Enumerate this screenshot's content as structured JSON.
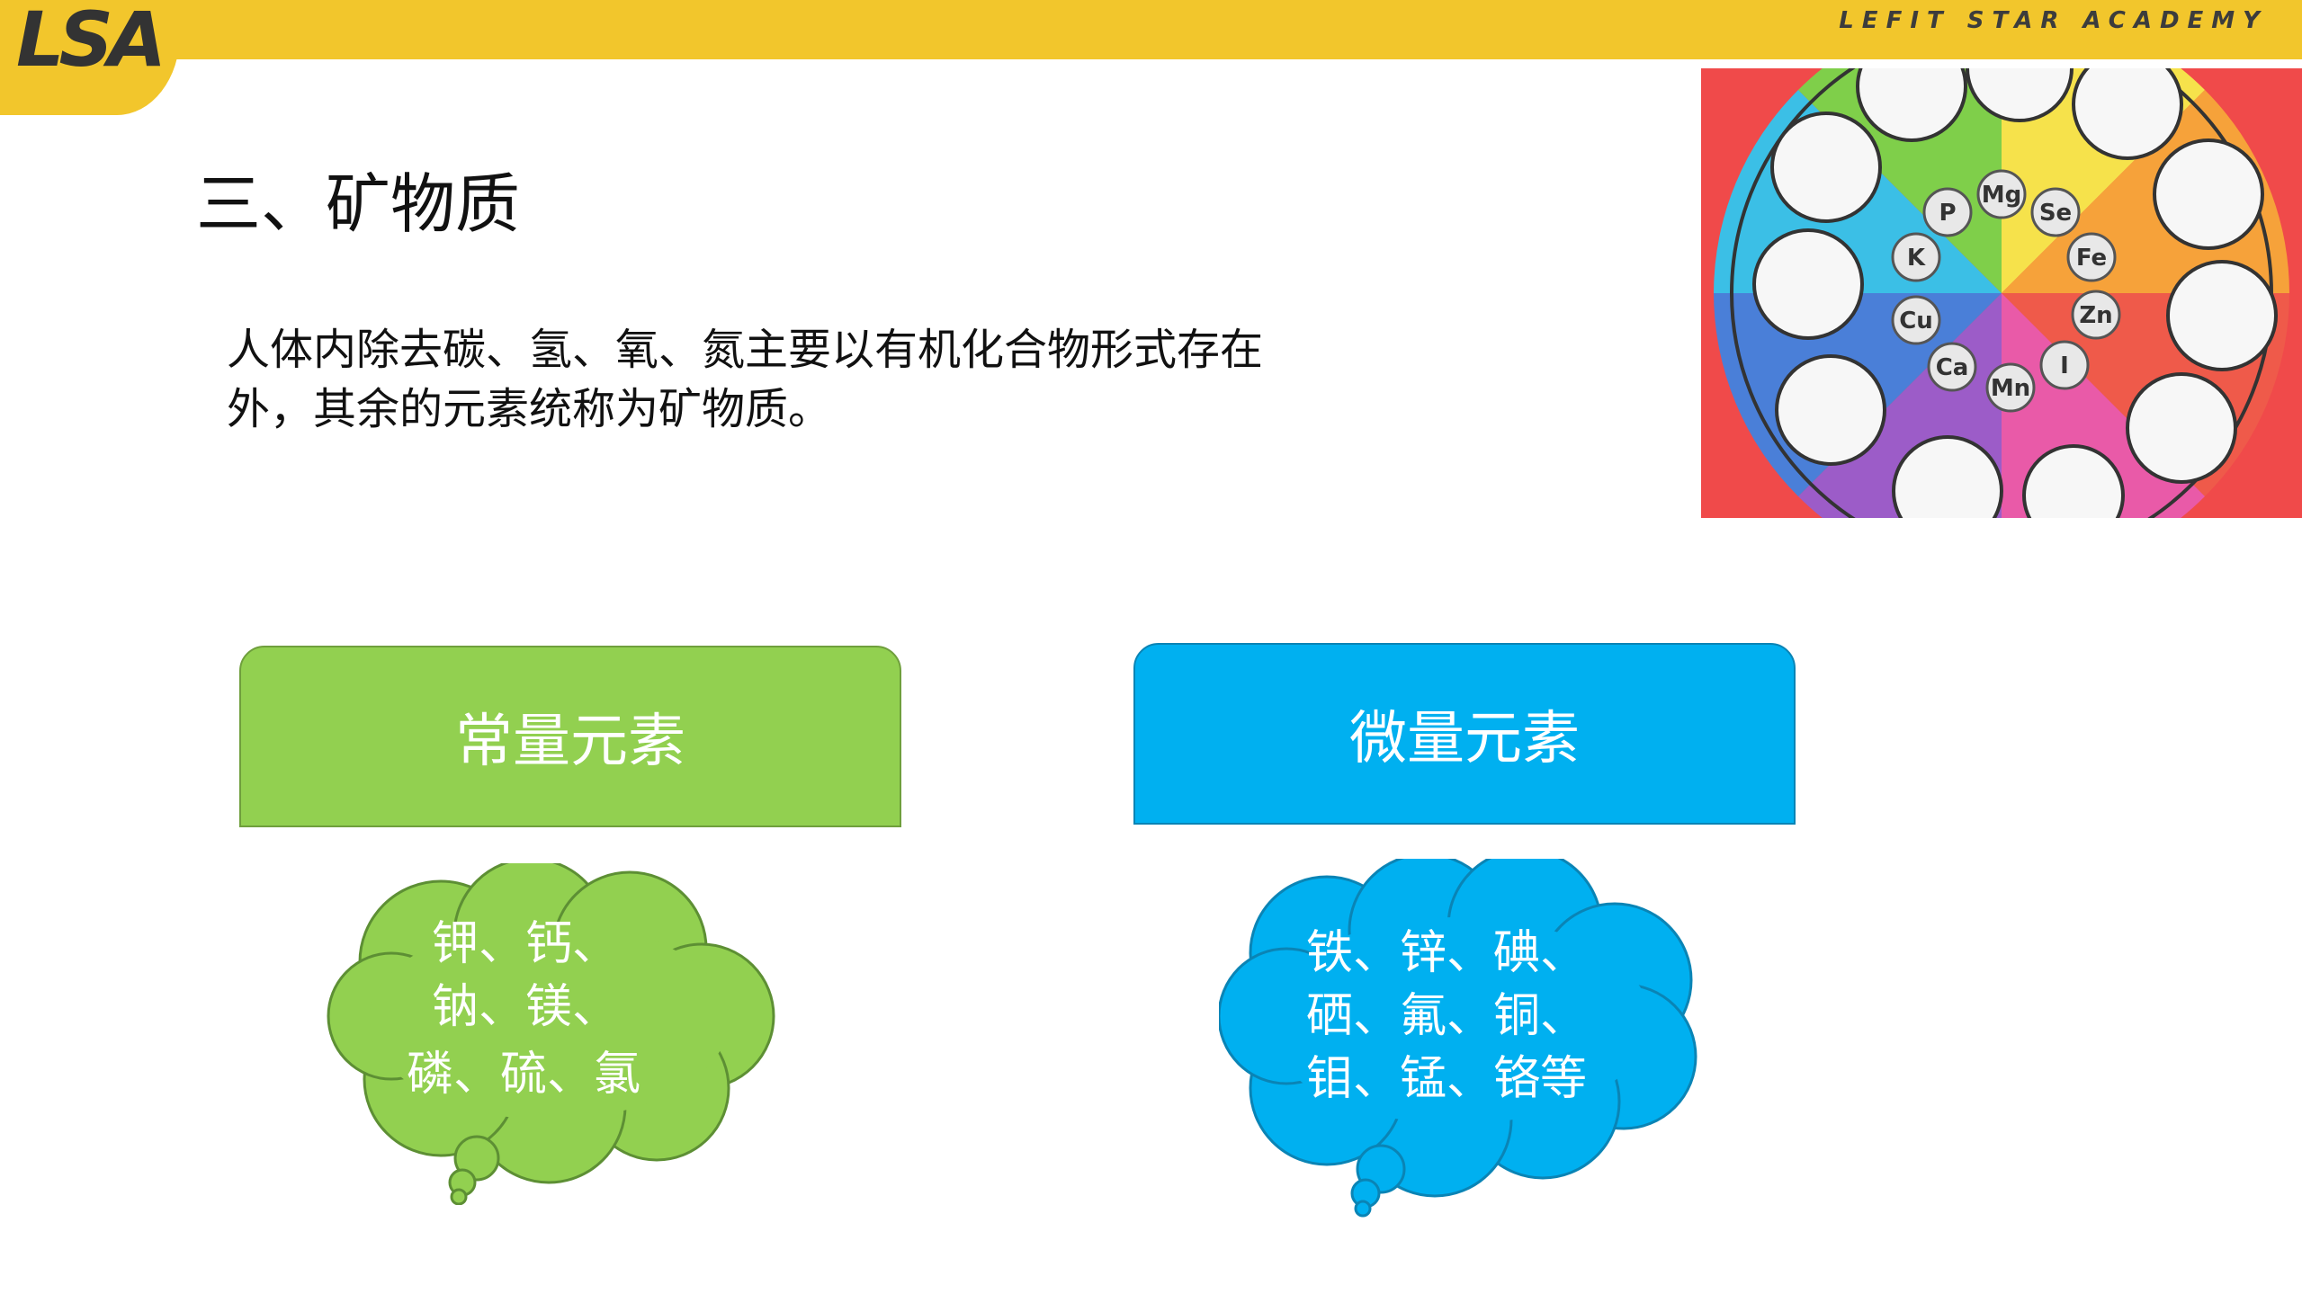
{
  "header": {
    "logo": "LSA",
    "academy": "LEFIT STAR ACADEMY"
  },
  "slide": {
    "title": "三、矿物质",
    "intro_line1": "人体内除去碳、氢、氧、氮主要以有机化合物形式存在",
    "intro_line2": "外，其余的元素统称为矿物质。"
  },
  "wheel": {
    "elements": [
      "Mg",
      "Se",
      "Fe",
      "Zn",
      "I",
      "Mn",
      "Ca",
      "Cu",
      "K",
      "P"
    ]
  },
  "categories": [
    {
      "label": "常量元素",
      "color": "#92d050",
      "items": [
        "钾、钙、",
        "钠、镁、",
        "磷、硫、氯"
      ]
    },
    {
      "label": "微量元素",
      "color": "#00b0f0",
      "items": [
        "铁、锌、碘、",
        "硒、氟、铜、",
        "钼、锰、铬等"
      ]
    }
  ]
}
